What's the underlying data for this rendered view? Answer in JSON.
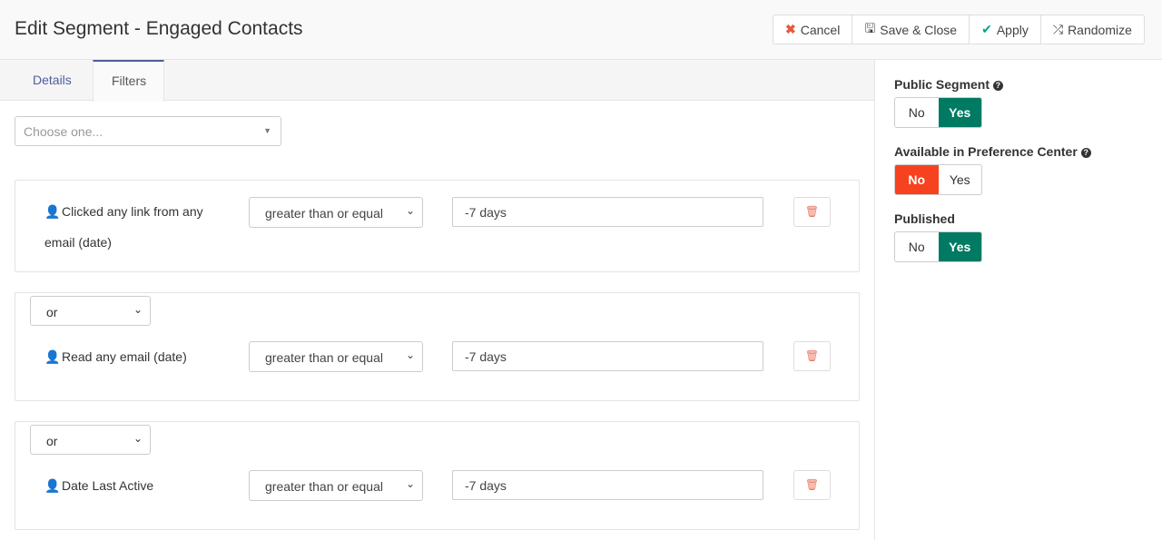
{
  "header": {
    "title": "Edit Segment - Engaged Contacts",
    "buttons": {
      "cancel": "Cancel",
      "save_close": "Save & Close",
      "apply": "Apply",
      "randomize": "Randomize"
    }
  },
  "tabs": [
    {
      "label": "Details"
    },
    {
      "label": "Filters"
    }
  ],
  "filter_picker": {
    "placeholder": "Choose one..."
  },
  "filters": [
    {
      "glue": null,
      "field": "Clicked any link from any email (date)",
      "operator": "greater than or equal",
      "value": "-7 days"
    },
    {
      "glue": "or",
      "field": "Read any email (date)",
      "operator": "greater than or equal",
      "value": "-7 days"
    },
    {
      "glue": "or",
      "field": "Date Last Active",
      "operator": "greater than or equal",
      "value": "-7 days"
    }
  ],
  "sidebar": {
    "public_segment": {
      "label": "Public Segment",
      "no": "No",
      "yes": "Yes",
      "selected": "Yes"
    },
    "preference_center": {
      "label": "Available in Preference Center",
      "no": "No",
      "yes": "Yes",
      "selected": "No"
    },
    "published": {
      "label": "Published",
      "no": "No",
      "yes": "Yes",
      "selected": "Yes"
    }
  },
  "colors": {
    "accent": "#4e5d9d",
    "yes_green": "#007a62",
    "no_red": "#f6421f"
  }
}
